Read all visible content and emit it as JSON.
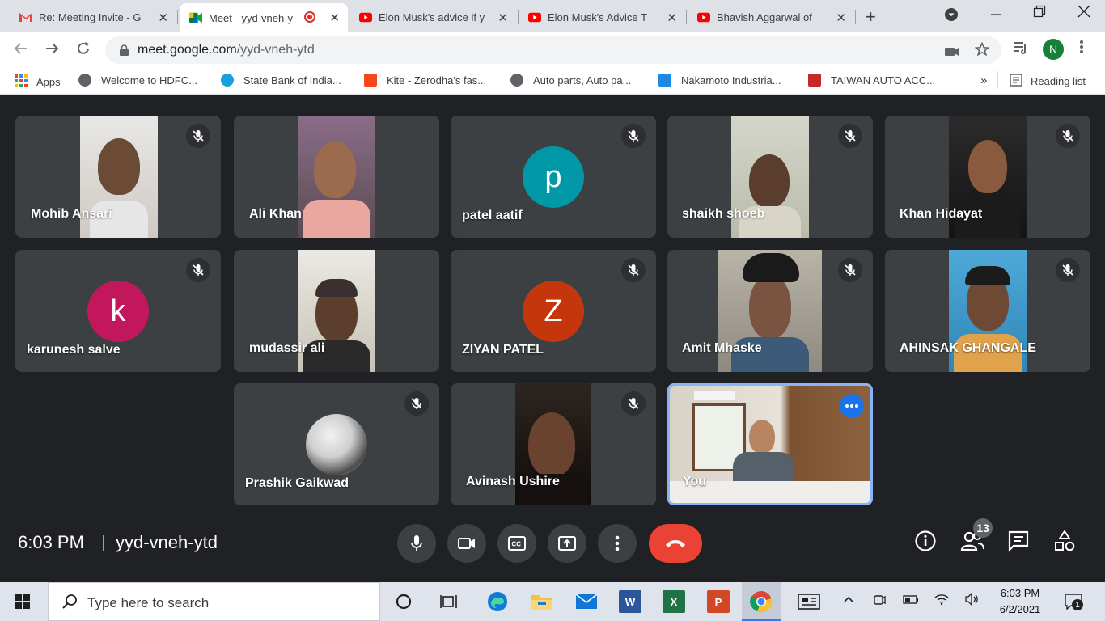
{
  "browser": {
    "tabs": [
      {
        "title": "Re: Meeting Invite - G",
        "favicon": "gmail-icon"
      },
      {
        "title": "Meet - yyd-vneh-ytd",
        "favicon": "meet-icon",
        "active": true,
        "recording": true
      },
      {
        "title": "Elon Musk's advice if y",
        "favicon": "youtube-icon"
      },
      {
        "title": "Elon Musk's Advice T",
        "favicon": "youtube-icon"
      },
      {
        "title": "Bhavish Aggarwal of",
        "favicon": "youtube-icon"
      }
    ],
    "url_host": "meet.google.com",
    "url_path": "/yyd-vneh-ytd",
    "profile_initial": "N",
    "bookmarks": [
      {
        "label": "Apps"
      },
      {
        "label": "Welcome to HDFC..."
      },
      {
        "label": "State Bank of India..."
      },
      {
        "label": "Kite - Zerodha's fas..."
      },
      {
        "label": "Auto parts, Auto pa..."
      },
      {
        "label": "Nakamoto Industria..."
      },
      {
        "label": "TAIWAN AUTO ACC..."
      }
    ],
    "reading_list": "Reading list",
    "overflow": "»"
  },
  "meet": {
    "participants": [
      {
        "name": "Mohib Ansari"
      },
      {
        "name": "Ali Khan"
      },
      {
        "name": "patel aatif",
        "initial": "p"
      },
      {
        "name": "shaikh shoeb"
      },
      {
        "name": "Khan Hidayat"
      },
      {
        "name": "karunesh salve",
        "initial": "k"
      },
      {
        "name": "mudassir ali"
      },
      {
        "name": "ZIYAN PATEL",
        "initial": "Z"
      },
      {
        "name": "Amit Mhaske"
      },
      {
        "name": "AHINSAK GHANGALE"
      },
      {
        "name": "Prashik Gaikwad"
      },
      {
        "name": "Avinash Ushire"
      },
      {
        "name": "You"
      }
    ],
    "time": "6:03 PM",
    "separator": "|",
    "meeting_code": "yyd-vneh-ytd",
    "participant_count": "13",
    "colors": {
      "avatar_p": "#0097a7",
      "avatar_k": "#c2185b",
      "avatar_z": "#c5360c",
      "end_call": "#ea4335",
      "speaker_border": "#8ab4f8"
    }
  },
  "taskbar": {
    "search_placeholder": "Type here to search",
    "clock_time": "6:03 PM",
    "clock_date": "6/2/2021",
    "notifications": "1"
  }
}
